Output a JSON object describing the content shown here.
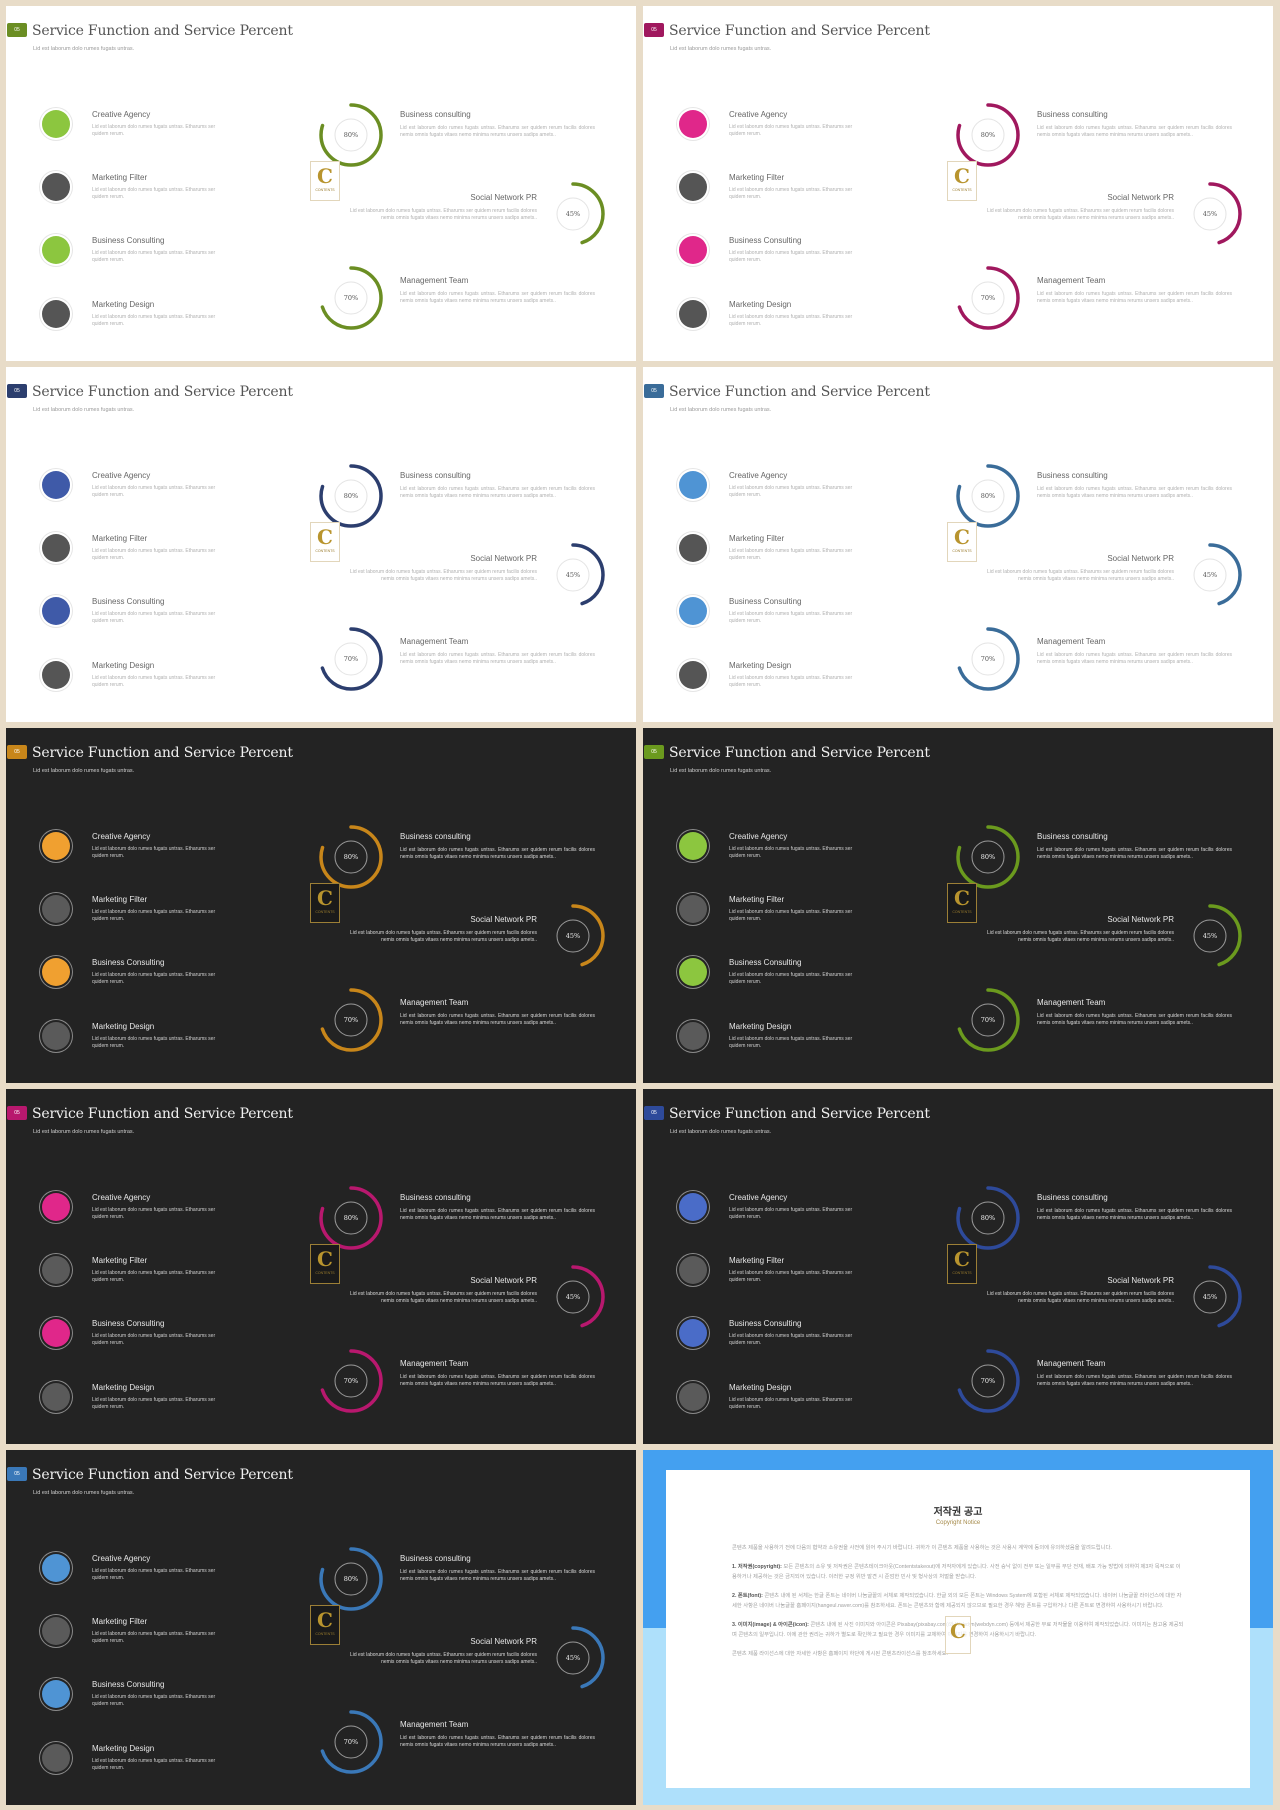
{
  "slide_common": {
    "title": "Service Function and Service Percent",
    "subtitle": "Lid est laborum dolo rumes fugats untras.",
    "badge": "05",
    "services": [
      {
        "title": "Creative Agency",
        "desc": "Lid est laborum dolo rumes fugats untras. Etharums ser quidem rerum.",
        "accent": true
      },
      {
        "title": "Marketing Filter",
        "desc": "Lid est laborum dolo rumes fugats untras. Etharums ser quidem rerum.",
        "accent": false
      },
      {
        "title": "Business Consulting",
        "desc": "Lid est laborum dolo rumes fugats untras. Etharums ser quidem rerum.",
        "accent": true
      },
      {
        "title": "Marketing Design",
        "desc": "Lid est laborum dolo rumes fugats untras. Etharums ser quidem rerum.",
        "accent": false
      }
    ],
    "gauges": [
      {
        "title": "Business consulting",
        "percent": 80,
        "label": "80%",
        "desc": "Lid est laborum dolo rumes fugats untras. Etharums ser quidem rerum facilis dolores nemis omnis fugats vitaes nemo minima rerums unsers sadips amets.."
      },
      {
        "title": "Social Network PR",
        "percent": 45,
        "label": "45%",
        "desc": "Lid est laborum dolo rumes fugats untras. Etharums ser quidem rerum facilis dolores nemis omnis fugats vitaes nemo minima rerums unsers sadips amets.."
      },
      {
        "title": "Management Team",
        "percent": 70,
        "label": "70%",
        "desc": "Lid est laborum dolo rumes fugats untras. Etharums ser quidem rerum facilis dolores nemis omnis fugats vitaes nemo minima rerums unsers sadips amets.."
      }
    ],
    "logo": {
      "letter": "C",
      "text": "CONTENTS"
    }
  },
  "slides": [
    {
      "theme": "light",
      "accent": "#6b8e23",
      "dot": "#8cc63f",
      "neutral": "#555555"
    },
    {
      "theme": "light",
      "accent": "#a0185e",
      "dot": "#e0278a",
      "neutral": "#555555"
    },
    {
      "theme": "light",
      "accent": "#2c3e6e",
      "dot": "#3f5aa8",
      "neutral": "#555555"
    },
    {
      "theme": "light",
      "accent": "#3a6c99",
      "dot": "#4f94d4",
      "neutral": "#555555"
    },
    {
      "theme": "dark",
      "accent": "#c8861a",
      "dot": "#f0a030",
      "neutral": "#555555"
    },
    {
      "theme": "dark",
      "accent": "#6b9a1e",
      "dot": "#8cc63f",
      "neutral": "#555555"
    },
    {
      "theme": "dark",
      "accent": "#b8186e",
      "dot": "#e0278a",
      "neutral": "#555555"
    },
    {
      "theme": "dark",
      "accent": "#2e4a9a",
      "dot": "#4a6cc8",
      "neutral": "#555555"
    },
    {
      "theme": "dark",
      "accent": "#3a78b8",
      "dot": "#4f94d4",
      "neutral": "#555555"
    }
  ],
  "copyright": {
    "heading": "저작권 공고",
    "subheading": "Copyright Notice",
    "intro": "콘텐츠 제품을 사용하기 전에 다음의 협약과 소유권을 사전에 읽어 주시기 바랍니다. 귀하가 이 콘텐츠 제품을 사용하는 것은 사용시 계약에 동의에 유의하셨음을 알려드립니다.",
    "sections": [
      {
        "label": "1. 저작권(copyright):",
        "text": "모든 콘텐츠의 소유 및 저작권은 콘텐츠테이크아웃(Contentstakeout)에 저작자에게 있습니다. 사전 승낙 없이 전부 또는 일부를 무단 전재, 배포 가능 방법에 의하여 제3자 목적으로 이용하거나 제공하는 것은 금지되어 있습니다. 이러한 규정 위반 발견 시 준엄한 민사 및 형사상의 처벌을 받습니다."
      },
      {
        "label": "2. 폰트(font):",
        "text": "콘텐츠 내에 된 서체는 한글 폰트는 네이버 나눔글꼴의 서체로 제작되었습니다. 한글 외의 모든 폰트는 Windows System에 포함된 서체로 제작되었습니다. 네이버 나눔글꼴 라이선스에 대한 자세한 사항은 네이버 나눔글꼴 홈페이지(hangeul.naver.com)를 참조하세요. 폰트는 콘텐츠와 함께 제공되지 않으므로 필요한 경우 해당 폰트를 구입하거나 다른 폰트로 변경하여 사용하시기 바랍니다."
      },
      {
        "label": "3. 이미지(image) & 아이콘(icon):",
        "text": "콘텐츠 내에 된 사진 이미지와 아이콘은 Pixabay(pixabay.com)와 Webdyn(webdyn.com) 등에서 제공한 무료 저작물을 이용하여 제작되었습니다. 이미지는 참고용 제공되며 콘텐츠의 일부입니다. 이에 관한 권리는 귀하가 별도로 확인하고 필요한 경우 이미지를 교체하여 이미지를 변경하여 사용하시기 바랍니다."
      }
    ],
    "outro": "콘텐츠 제품 라이선스에 대한 자세한 사항은 홈페이지 하단에 게시된 콘텐츠라이선스를 참조하세요."
  }
}
